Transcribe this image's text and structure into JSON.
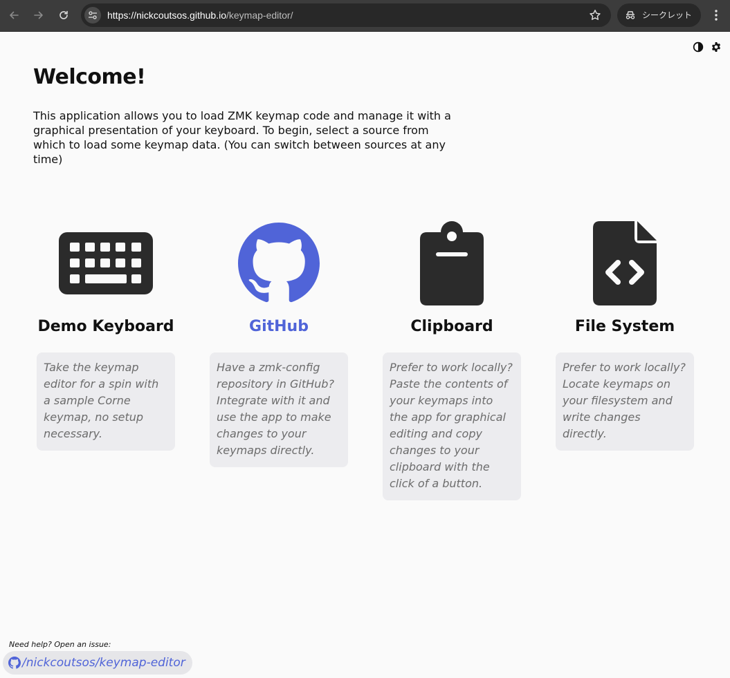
{
  "browser": {
    "url_host": "https://nickcoutsos.github.io",
    "url_path": "/keymap-editor/",
    "incognito_label": "シークレット"
  },
  "page": {
    "title": "Welcome!",
    "intro": "This application allows you to load ZMK keymap code and manage it with a graphical presentation of your keyboard. To begin, select a source from which to load some keymap data. (You can switch between sources at any time)",
    "sources": [
      {
        "name": "Demo Keyboard",
        "icon": "keyboard-icon",
        "description": "Take the keymap editor for a spin with a sample Corne keymap, no setup necessary."
      },
      {
        "name": "GitHub",
        "icon": "github-icon",
        "description": "Have a zmk-config repository in GitHub? Integrate with it and use the app to make changes to your keymaps directly."
      },
      {
        "name": "Clipboard",
        "icon": "clipboard-icon",
        "description": "Prefer to work locally? Paste the contents of your keymaps into the app for graphical editing and copy changes to your clipboard with the click of a button."
      },
      {
        "name": "File System",
        "icon": "file-code-icon",
        "description": "Prefer to work locally? Locate keymaps on your filesystem and write changes directly."
      }
    ],
    "help_note": "Need help? Open an issue:",
    "repo_link": "/nickcoutsos/keymap-editor"
  },
  "colors": {
    "accent": "#5064d8",
    "icon_dark": "#2b2b2b",
    "card_bg": "#ececef",
    "browser_bar": "#3c3c3c"
  }
}
